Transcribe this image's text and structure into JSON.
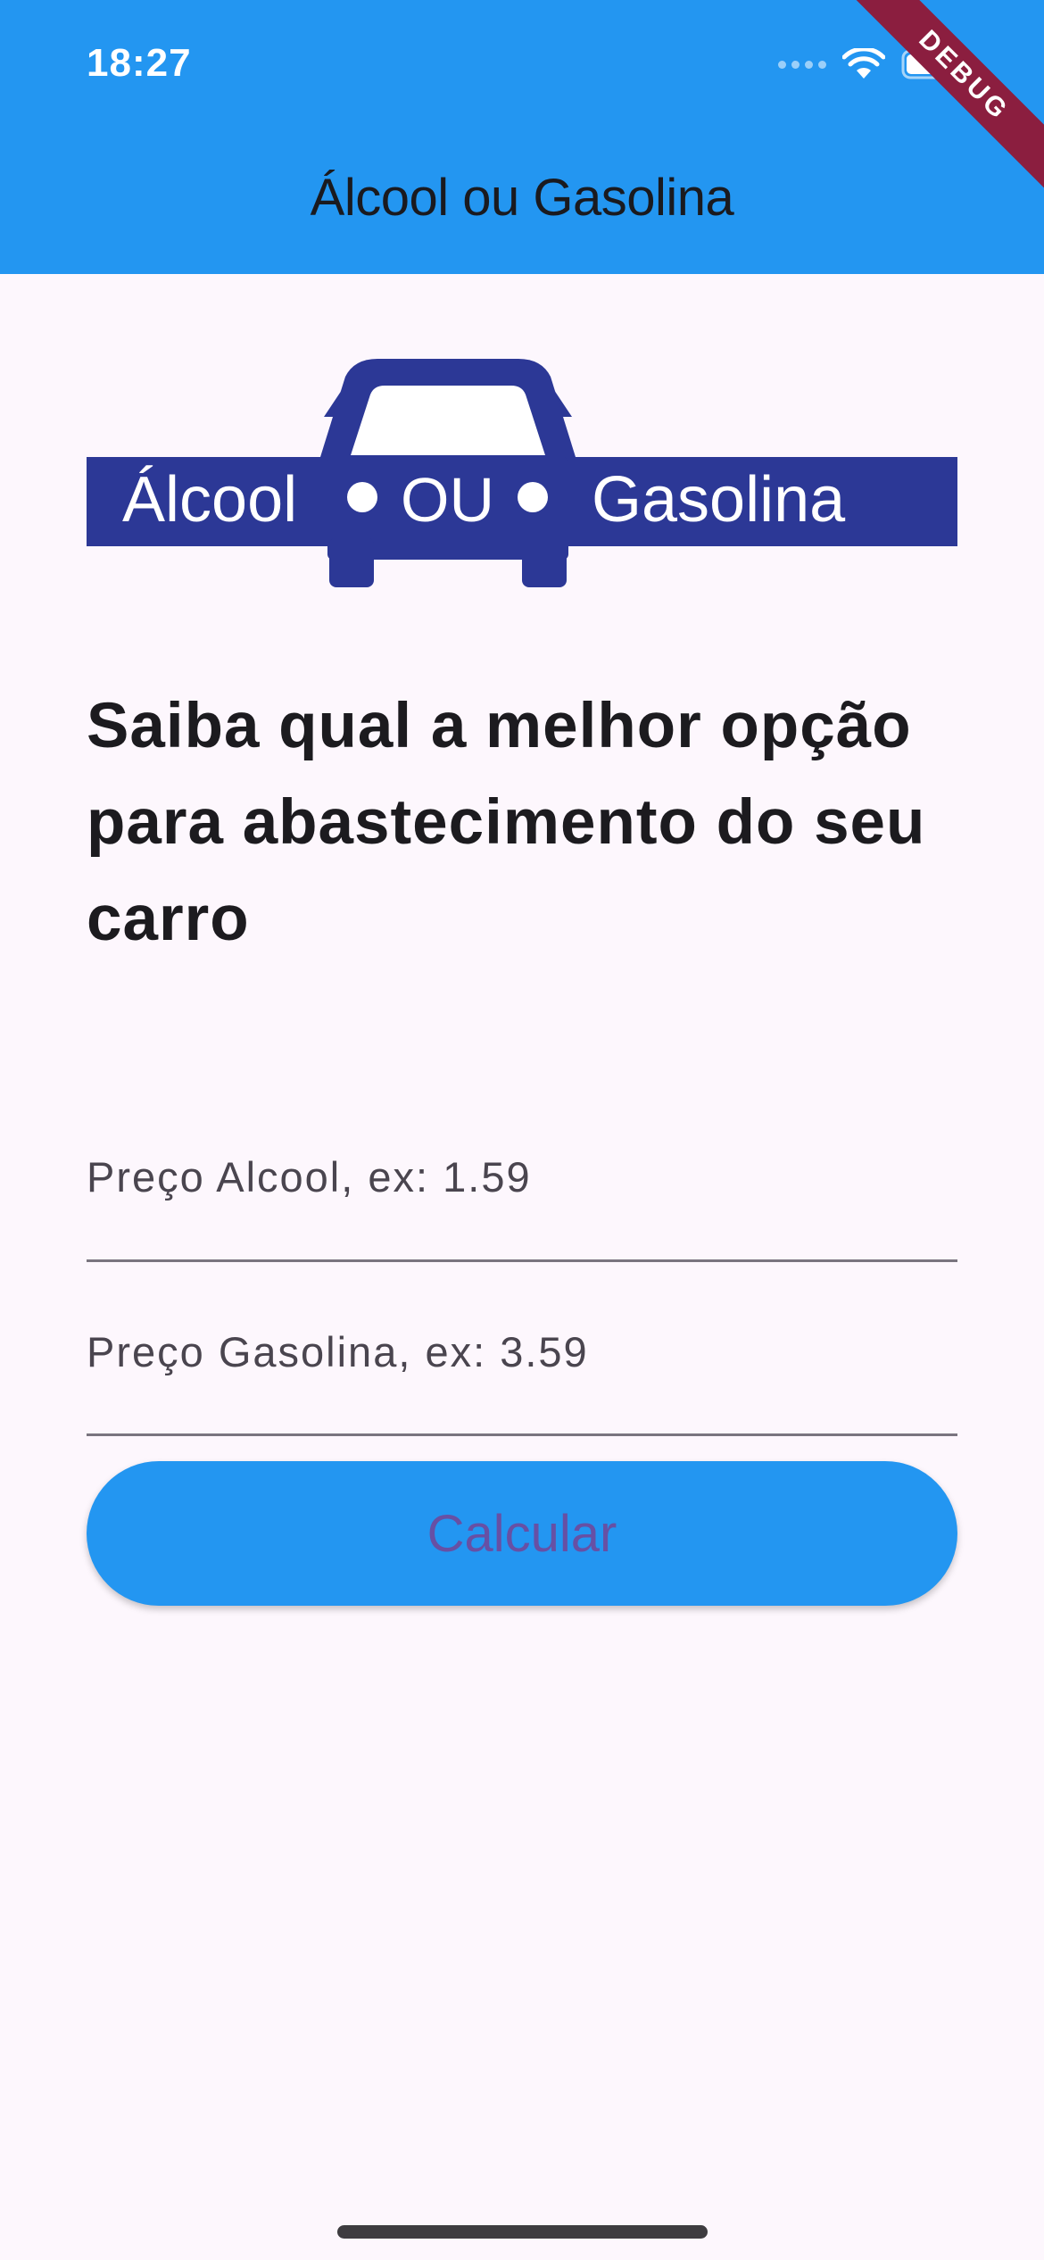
{
  "status_bar": {
    "time": "18:27",
    "icons": [
      "cellular-signal-icon",
      "wifi-icon",
      "battery-icon"
    ]
  },
  "debug_banner": "DEBUG",
  "app_bar": {
    "title": "Álcool ou Gasolina",
    "background_color": "#2396F1"
  },
  "logo": {
    "left_word": "Álcool",
    "middle_word": "OU",
    "right_word": "Gasolina",
    "color": "#2C3896"
  },
  "headline": "Saiba qual a melhor opção para abastecimento do seu carro",
  "form": {
    "alcool_placeholder": "Preço Alcool, ex: 1.59",
    "alcool_value": "",
    "gasolina_placeholder": "Preço Gasolina, ex: 3.59",
    "gasolina_value": "",
    "button_label": "Calcular"
  },
  "colors": {
    "accent": "#2396F1",
    "button_text": "#6750A4",
    "background": "#FDF7FD"
  }
}
